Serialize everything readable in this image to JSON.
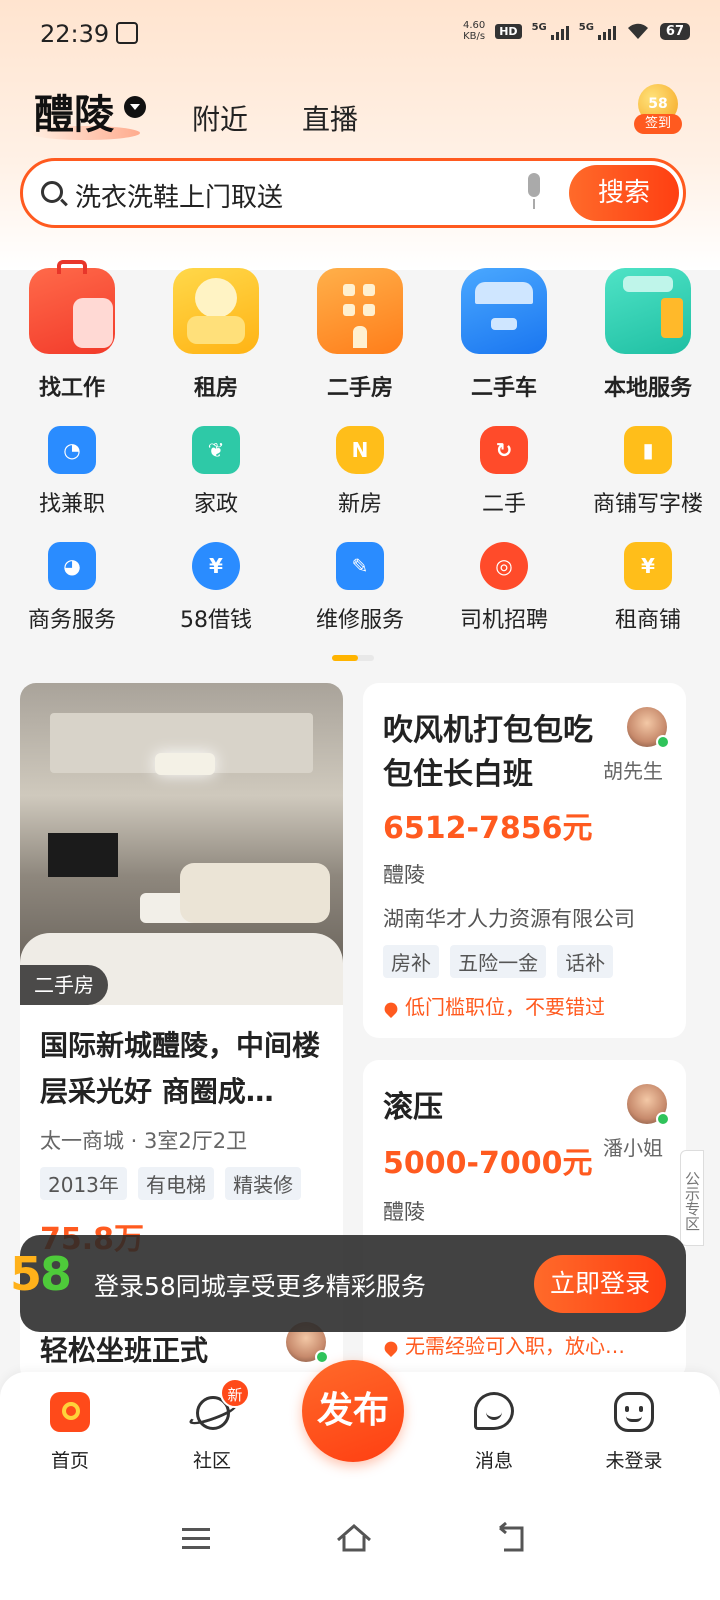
{
  "status_bar": {
    "time": "22:39",
    "speed_value": "4.60",
    "speed_unit": "KB/s",
    "hd": "HD",
    "net1": "5G",
    "net2": "5G",
    "battery": "67"
  },
  "header": {
    "city": "醴陵",
    "tabs": [
      "附近",
      "直播"
    ],
    "signin_badge": "58",
    "signin_label": "签到"
  },
  "search": {
    "placeholder": "洗衣洗鞋上门取送",
    "button": "搜索"
  },
  "main_categories": [
    {
      "label": "找工作",
      "icon": "briefcase-icon",
      "color": "#ff4b3a"
    },
    {
      "label": "租房",
      "icon": "teddy-bear-sofa-icon",
      "color": "#ffc21c"
    },
    {
      "label": "二手房",
      "icon": "building-icon",
      "color": "#ff8f2a"
    },
    {
      "label": "二手车",
      "icon": "car-icon",
      "color": "#2e8cff"
    },
    {
      "label": "本地服务",
      "icon": "paint-roller-icon",
      "color": "#2fd0b5"
    }
  ],
  "sub_categories_row1": [
    {
      "label": "找兼职",
      "icon": "clock-icon",
      "color": "#2a8cff",
      "glyph": "◔"
    },
    {
      "label": "家政",
      "icon": "sprout-icon",
      "color": "#2ec9a7",
      "glyph": "❦"
    },
    {
      "label": "新房",
      "icon": "new-house-icon",
      "color": "#ffbe1a",
      "glyph": "N"
    },
    {
      "label": "二手",
      "icon": "recycle-star-icon",
      "color": "#ff4b2a",
      "glyph": "↻"
    },
    {
      "label": "商铺写字楼",
      "icon": "office-icon",
      "color": "#ffbe1a",
      "glyph": "▮"
    }
  ],
  "sub_categories_row2": [
    {
      "label": "商务服务",
      "icon": "presentation-icon",
      "color": "#2a8cff",
      "glyph": "◕"
    },
    {
      "label": "58借钱",
      "icon": "yuan-coin-icon",
      "color": "#2a8cff",
      "glyph": "¥"
    },
    {
      "label": "维修服务",
      "icon": "wrench-icon",
      "color": "#2a8cff",
      "glyph": "✎"
    },
    {
      "label": "司机招聘",
      "icon": "steering-wheel-icon",
      "color": "#ff4b2a",
      "glyph": "◎"
    },
    {
      "label": "租商铺",
      "icon": "shop-yuan-icon",
      "color": "#ffbe1a",
      "glyph": "¥"
    }
  ],
  "feed": {
    "house_card": {
      "tag": "二手房",
      "title": "国际新城醴陵，中间楼层采光好 商圈成…",
      "subtitle": "太一商城 · 3室2厅2卫",
      "chips": [
        "2013年",
        "有电梯",
        "精装修"
      ],
      "price_partial": "75.8万"
    },
    "job_card_1": {
      "title": "吹风机打包包吃包住长白班",
      "poster": "胡先生",
      "salary": "6512-7856元",
      "location": "醴陵",
      "company": "湖南华才人力资源有限公司",
      "chips": [
        "房补",
        "五险一金",
        "话补"
      ],
      "hint": "低门槛职位，不要错过"
    },
    "job_card_2": {
      "title": "滚压",
      "poster": "潘小姐",
      "salary": "5000-7000元",
      "location": "醴陵",
      "hint": "无需经验可入职，放心…"
    },
    "job_card_3": {
      "title": "轻松坐班正式"
    },
    "notice_tab": "公示专区"
  },
  "login_banner": {
    "text": "登录58同城享受更多精彩服务",
    "button": "立即登录"
  },
  "bottom_nav": {
    "items": [
      "首页",
      "社区",
      "消息",
      "未登录"
    ],
    "publish": "发布",
    "new_badge": "新"
  }
}
